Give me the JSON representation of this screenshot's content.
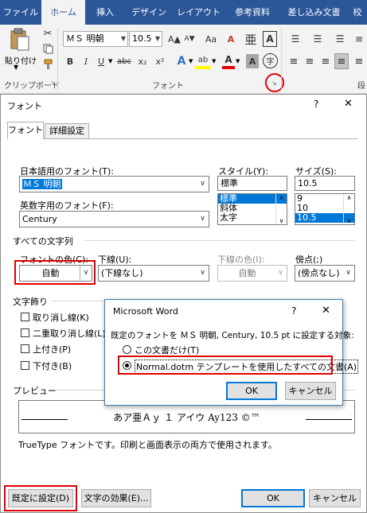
{
  "ribbon": {
    "tabs": [
      "ファイル",
      "ホーム",
      "挿入",
      "デザイン",
      "レイアウト",
      "参考資料",
      "差し込み文書",
      "校"
    ],
    "active_tab": "ホーム",
    "clipboard": {
      "paste_label": "貼り付け",
      "group_label": "クリップボード"
    },
    "font": {
      "font_name": "ＭＳ 明朝",
      "font_size": "10.5",
      "group_label": "フォント",
      "bold": "B",
      "italic": "I",
      "underline": "U",
      "strike": "abc",
      "subscript": "x₂",
      "superscript": "x²",
      "grow": "A▲",
      "shrink": "A▼",
      "case": "Aa",
      "clear": "A",
      "effects": "A",
      "highlight": "ab",
      "color": "A",
      "shade": "A",
      "circle": "字"
    },
    "paragraph_group_label": "段"
  },
  "dialog": {
    "title": "フォント",
    "help": "?",
    "close": "✕",
    "tabs": [
      "フォント",
      "詳細設定"
    ],
    "jp_font_label": "日本語用のフォント(T):",
    "jp_font_value": "ＭＳ 明朝",
    "en_font_label": "英数字用のフォント(F):",
    "en_font_value": "Century",
    "style_label": "スタイル(Y):",
    "style_value": "標準",
    "style_options": [
      "標準",
      "斜体",
      "太字"
    ],
    "size_label": "サイズ(S):",
    "size_value": "10.5",
    "size_options": [
      "9",
      "10",
      "10.5"
    ],
    "all_text_label": "すべての文字列",
    "font_color_label": "フォントの色(C):",
    "font_color_value": "自動",
    "underline_label": "下線(U):",
    "underline_value": "(下線なし)",
    "underline_color_label": "下線の色(I):",
    "underline_color_value": "自動",
    "emphasis_label": "傍点(;)",
    "emphasis_value": "(傍点なし)",
    "effects_label": "文字飾り",
    "effects": [
      "取り消し線(K)",
      "二重取り消し線(L)",
      "上付き(P)",
      "下付き(B)"
    ],
    "preview_label": "プレビュー",
    "preview_text": "あア亜Ａｙ １ アイウ Ay123 ©™",
    "note": "TrueType フォントです。印刷と画面表示の両方で使用されます。",
    "set_default": "既定に設定(D)",
    "text_effects": "文字の効果(E)...",
    "ok": "OK",
    "cancel": "キャンセル"
  },
  "msgbox": {
    "title": "Microsoft Word",
    "help": "?",
    "close": "✕",
    "prompt": "既定のフォントを ＭＳ 明朝, Century, 10.5 pt に設定する対象:",
    "option1": "この文書だけ(T)",
    "option2": "Normal.dotm テンプレートを使用したすべての文書(A)",
    "ok": "OK",
    "cancel": "キャンセル"
  },
  "colors": {
    "ribbon_blue": "#2b579a",
    "highlight_red": "#e00000",
    "selection": "#0078d7"
  }
}
